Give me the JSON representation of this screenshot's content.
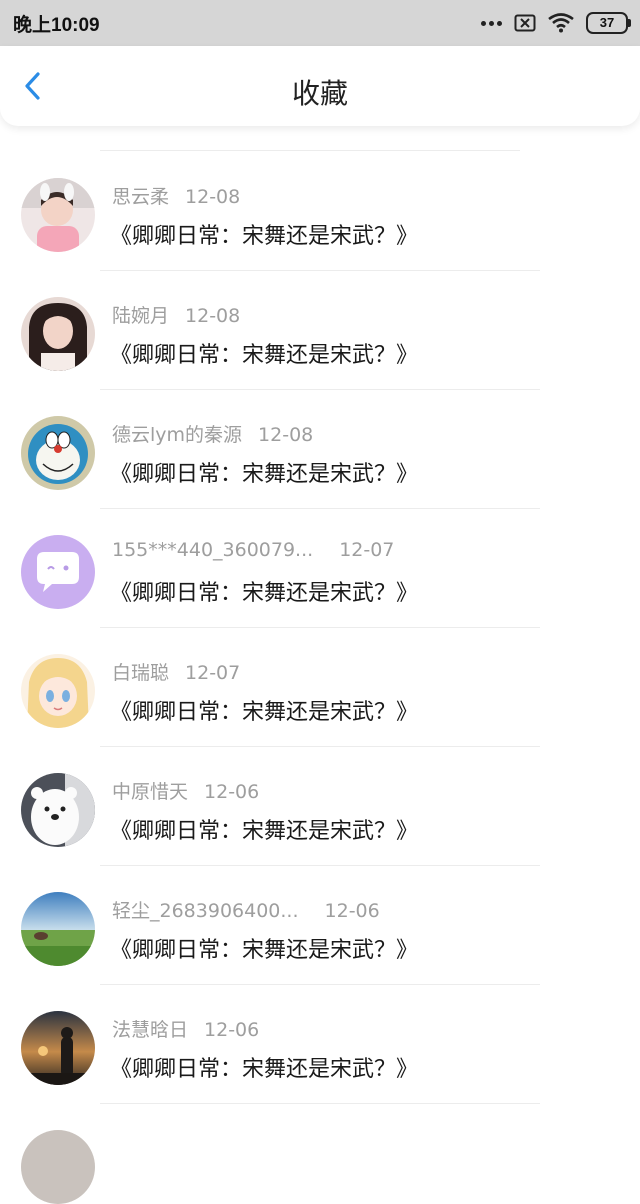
{
  "status_bar": {
    "time": "晚上10:09",
    "battery": "37"
  },
  "header": {
    "title": "收藏"
  },
  "items": [
    {
      "name": "思云柔",
      "date": "12-08",
      "title": "《卿卿日常：宋舞还是宋武？》",
      "avatar": "child-photo-avatar"
    },
    {
      "name": "陆婉月",
      "date": "12-08",
      "title": "《卿卿日常：宋舞还是宋武？》",
      "avatar": "woman-photo-avatar"
    },
    {
      "name": "德云lym的秦源",
      "date": "12-08",
      "title": "《卿卿日常：宋舞还是宋武？》",
      "avatar": "doraemon-avatar"
    },
    {
      "name": "155***440_360079...",
      "date": "12-07",
      "title": "《卿卿日常：宋舞还是宋武？》",
      "avatar": "chat-bubble-avatar"
    },
    {
      "name": "白瑞聪",
      "date": "12-07",
      "title": "《卿卿日常：宋舞还是宋武？》",
      "avatar": "anime-girl-avatar"
    },
    {
      "name": "中原惜天",
      "date": "12-06",
      "title": "《卿卿日常：宋舞还是宋武？》",
      "avatar": "polar-bear-avatar"
    },
    {
      "name": "轻尘_2683906400...",
      "date": "12-06",
      "title": "《卿卿日常：宋舞还是宋武？》",
      "avatar": "landscape-avatar"
    },
    {
      "name": "法慧晗日",
      "date": "12-06",
      "title": "《卿卿日常：宋舞还是宋武？》",
      "avatar": "sunset-person-avatar"
    }
  ],
  "colors": {
    "accent": "#2b8ce6",
    "status_bar_bg": "#d6d6d6",
    "meta_text": "#9e9e9e"
  }
}
